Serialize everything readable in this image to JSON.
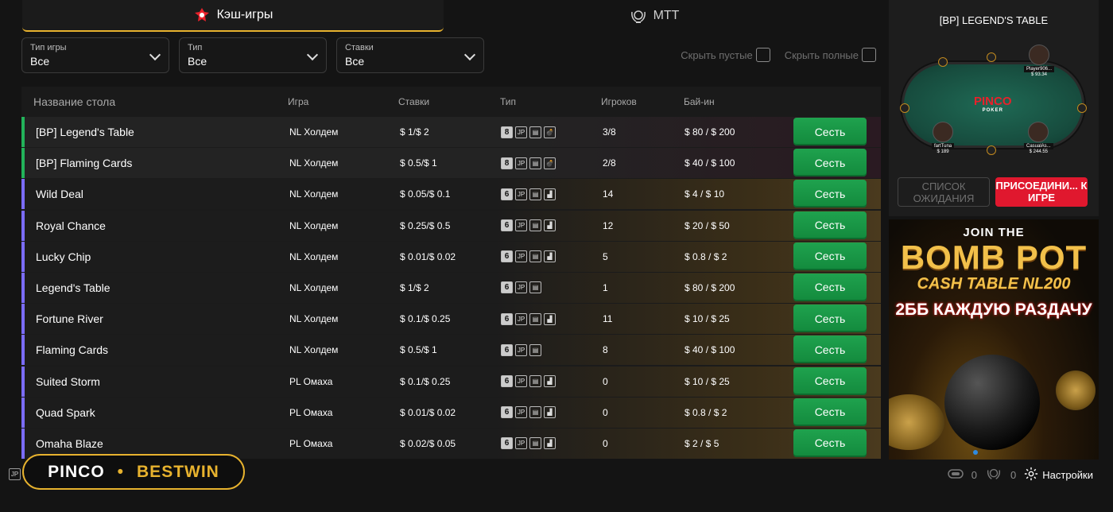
{
  "tabs": [
    {
      "label": "Кэш-игры",
      "icon": "cash-games-icon",
      "active": true
    },
    {
      "label": "MTT",
      "icon": "laurel-trophy-icon",
      "active": false
    }
  ],
  "filters": {
    "game_type": {
      "label": "Тип игры",
      "value": "Все"
    },
    "type": {
      "label": "Тип",
      "value": "Все"
    },
    "stakes": {
      "label": "Ставки",
      "value": "Все"
    },
    "hide_empty": "Скрыть пустые",
    "hide_full": "Скрыть полные"
  },
  "columns": {
    "name": "Название стола",
    "game": "Игра",
    "stakes": "Ставки",
    "type": "Тип",
    "players": "Игроков",
    "buyin": "Бай-ин"
  },
  "sit_label": "Сесть",
  "rows": [
    {
      "name": "[BP] Legend's  Table",
      "game": "NL Холдем",
      "stakes": "$ 1/$ 2",
      "max": "8",
      "players": "3/8",
      "buyin": "$ 80 / $ 200",
      "bp": true
    },
    {
      "name": "[BP] Flaming Cards",
      "game": "NL Холдем",
      "stakes": "$ 0.5/$ 1",
      "max": "8",
      "players": "2/8",
      "buyin": "$ 40 / $ 100",
      "bp": true
    },
    {
      "name": "Wild Deal",
      "game": "NL Холдем",
      "stakes": "$ 0.05/$ 0.1",
      "max": "6",
      "players": "14",
      "buyin": "$ 4 / $ 10",
      "bp": false
    },
    {
      "name": "Royal Chance",
      "game": "NL Холдем",
      "stakes": "$ 0.25/$ 0.5",
      "max": "6",
      "players": "12",
      "buyin": "$ 20 / $ 50",
      "bp": false
    },
    {
      "name": "Lucky Chip",
      "game": "NL Холдем",
      "stakes": "$ 0.01/$ 0.02",
      "max": "6",
      "players": "5",
      "buyin": "$ 0.8 / $ 2",
      "bp": false
    },
    {
      "name": "Legend's Table",
      "game": "NL Холдем",
      "stakes": "$ 1/$ 2",
      "max": "6",
      "players": "1",
      "buyin": "$ 80 / $ 200",
      "bp": false,
      "no_stats": true
    },
    {
      "name": "Fortune River",
      "game": "NL Холдем",
      "stakes": "$ 0.1/$ 0.25",
      "max": "6",
      "players": "11",
      "buyin": "$ 10 / $ 25",
      "bp": false
    },
    {
      "name": "Flaming Cards",
      "game": "NL Холдем",
      "stakes": "$ 0.5/$ 1",
      "max": "6",
      "players": "8",
      "buyin": "$ 40 / $ 100",
      "bp": false,
      "no_stats": true
    },
    {
      "name": "Suited Storm",
      "game": "PL Омаха",
      "stakes": "$ 0.1/$ 0.25",
      "max": "6",
      "players": "0",
      "buyin": "$ 10 / $ 25",
      "bp": false
    },
    {
      "name": "Quad Spark",
      "game": "PL Омаха",
      "stakes": "$ 0.01/$ 0.02",
      "max": "6",
      "players": "0",
      "buyin": "$ 0.8 / $ 2",
      "bp": false
    },
    {
      "name": "Omaha Blaze",
      "game": "PL Омаха",
      "stakes": "$ 0.02/$ 0.05",
      "max": "6",
      "players": "0",
      "buyin": "$ 2 / $ 5",
      "bp": false
    }
  ],
  "badges": {
    "jp": "JP"
  },
  "brand": {
    "left": "PINCO",
    "dot": "•",
    "right": "BESTWIN"
  },
  "footer": {
    "tables_count": "0",
    "tourney_count": "0",
    "settings": "Настройки",
    "jp": "JP"
  },
  "preview": {
    "title": "[BP] LEGEND'S TABLE",
    "logo": "PINCO",
    "logo_sub": "POKER",
    "players": [
      {
        "name": "Player906...",
        "stack": "$ 93.34"
      },
      {
        "name": "fartTuna",
        "stack": "$ 189"
      },
      {
        "name": "CasualAs...",
        "stack": "$ 244.55"
      }
    ],
    "waitlist": "СПИСОК ОЖИДАНИЯ",
    "join": "ПРИСОЕДИНИ... К ИГРЕ"
  },
  "banner": {
    "line1": "JOIN THE",
    "line2": "BOMB POT",
    "line3": "CASH TABLE  NL200",
    "line4": "2ББ КАЖДУЮ РАЗДАЧУ"
  },
  "colors": {
    "accent": "#e7b22e",
    "sit": "#1fa24e",
    "bp_bar": "#22b35a",
    "row_bar": "#7b6cff",
    "join": "#e0182e"
  }
}
